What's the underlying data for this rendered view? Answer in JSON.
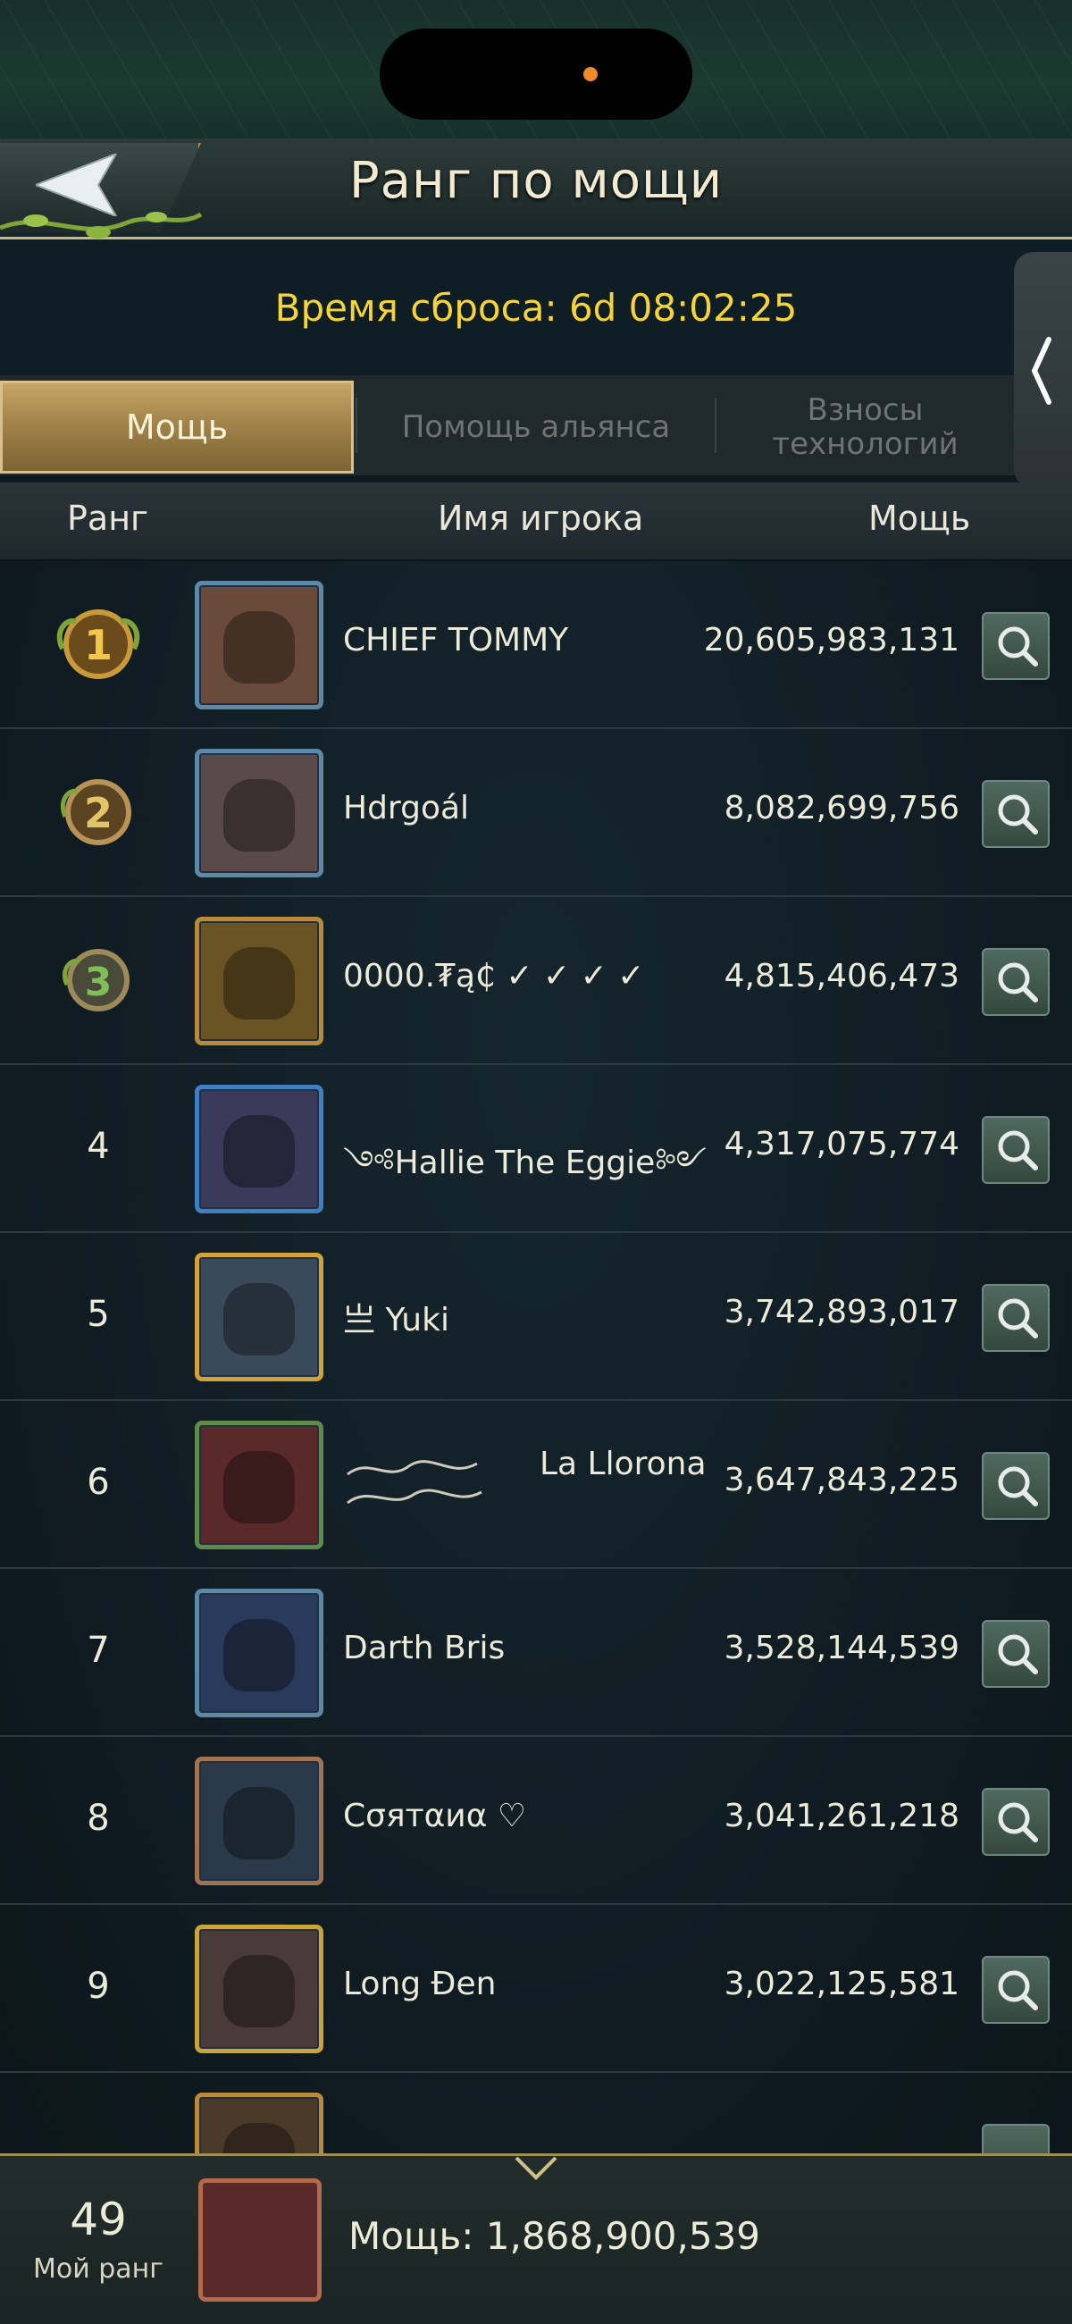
{
  "header": {
    "title": "Ранг по мощи",
    "back_icon": "back-arrow-icon"
  },
  "reset": {
    "text": "Время сброса: 6d 08:02:25"
  },
  "tabs": [
    {
      "label": "Мощь",
      "active": true
    },
    {
      "label": "Помощь альянса",
      "active": false
    },
    {
      "label": "Взносы технологий",
      "active": false
    }
  ],
  "columns": {
    "rank": "Ранг",
    "name": "Имя игрока",
    "power": "Мощь"
  },
  "rows": [
    {
      "rank": "1",
      "name": "CHIEF TOMMY",
      "power": "20,605,983,131",
      "avatar_color": "#5d88a8"
    },
    {
      "rank": "2",
      "name": "Hdrgoál",
      "power": "8,082,699,756",
      "avatar_color": "#5d88a8"
    },
    {
      "rank": "3",
      "name": "0000.₮ą₵ ✓ ✓ ✓ ✓",
      "power": "4,815,406,473",
      "avatar_color": "#b88a3a"
    },
    {
      "rank": "4",
      "name": "༺Hallie The Eggie༻",
      "power": "4,317,075,774",
      "avatar_color": "#3f7fc2"
    },
    {
      "rank": "5",
      "name": "亗 Yuki",
      "power": "3,742,893,017",
      "avatar_color": "#d2a33a"
    },
    {
      "rank": "6",
      "name": "La Llorona",
      "power": "3,647,843,225",
      "avatar_color": "#5f8a4a"
    },
    {
      "rank": "7",
      "name": "Darth Bris",
      "power": "3,528,144,539",
      "avatar_color": "#5d88a8"
    },
    {
      "rank": "8",
      "name": "Cσятαиα ♡",
      "power": "3,041,261,218",
      "avatar_color": "#a07450"
    },
    {
      "rank": "9",
      "name": "Long Đen",
      "power": "3,022,125,581",
      "avatar_color": "#c9a43a"
    }
  ],
  "my_rank": {
    "rank": "49",
    "label": "Мой ранг",
    "power": "Мощь: 1,868,900,539"
  },
  "colors": {
    "accent_yellow": "#f5d33a",
    "gold_tab": "#b79356",
    "search_btn": "#4f6a60"
  }
}
